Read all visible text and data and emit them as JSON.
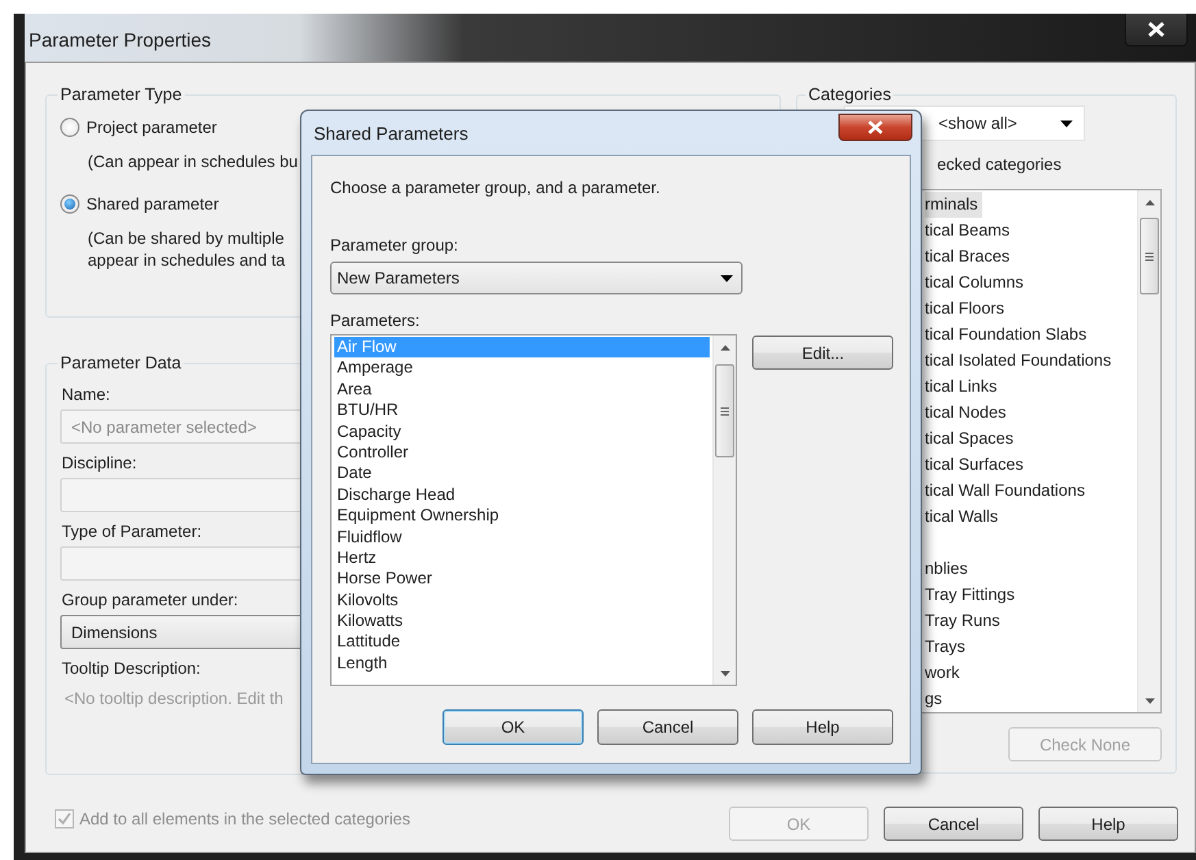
{
  "window": {
    "title": "Parameter Properties"
  },
  "parameter_type": {
    "title": "Parameter Type",
    "options": [
      {
        "label": "Project parameter",
        "note": [
          "(Can appear in schedules bu"
        ],
        "selected": false
      },
      {
        "label": "Shared parameter",
        "note": [
          "(Can be shared by multiple",
          "appear in schedules and ta"
        ],
        "selected": true
      }
    ]
  },
  "parameter_data": {
    "title": "Parameter Data",
    "fields": [
      {
        "kind": "text",
        "label": "Name:",
        "placeholder": "<No parameter selected>",
        "disabled": true
      },
      {
        "kind": "select",
        "label": "Discipline:",
        "disabled": true
      },
      {
        "kind": "select",
        "label": "Type of Parameter:",
        "disabled": true
      },
      {
        "kind": "select",
        "label": "Group parameter under:",
        "value": "Dimensions",
        "disabled": false
      },
      {
        "kind": "note",
        "label": "Tooltip Description:",
        "value": "<No tooltip description. Edit th"
      }
    ]
  },
  "categories": {
    "title": "Categories",
    "filter": "<show all>",
    "hide_unchecked_label": "ecked categories",
    "items": [
      {
        "label": "rminals",
        "selected": true
      },
      {
        "label": "tical Beams",
        "selected": false
      },
      {
        "label": "tical Braces",
        "selected": false
      },
      {
        "label": "tical Columns",
        "selected": false
      },
      {
        "label": "tical Floors",
        "selected": false
      },
      {
        "label": "tical Foundation Slabs",
        "selected": false
      },
      {
        "label": "tical Isolated Foundations",
        "selected": false
      },
      {
        "label": "tical Links",
        "selected": false
      },
      {
        "label": "tical Nodes",
        "selected": false
      },
      {
        "label": "tical Spaces",
        "selected": false
      },
      {
        "label": "tical Surfaces",
        "selected": false
      },
      {
        "label": "tical Wall Foundations",
        "selected": false
      },
      {
        "label": "tical Walls",
        "selected": false
      },
      {
        "label": "nblies",
        "selected": false
      },
      {
        "label": "Tray Fittings",
        "selected": false
      },
      {
        "label": "Tray Runs",
        "selected": false
      },
      {
        "label": "Trays",
        "selected": false
      },
      {
        "label": "work",
        "selected": false
      },
      {
        "label": "gs",
        "selected": false
      }
    ],
    "buttons": [
      {
        "label": "Check None",
        "disabled": true
      }
    ]
  },
  "add_to_all": {
    "label": "Add to all elements in the selected categories",
    "checked": true,
    "disabled": true
  },
  "buttons": [
    {
      "label": "OK",
      "disabled": true
    },
    {
      "label": "Cancel",
      "disabled": false
    },
    {
      "label": "Help",
      "disabled": false
    }
  ],
  "shared_dialog": {
    "title": "Shared Parameters",
    "instruction": "Choose a parameter group, and a parameter.",
    "group_label": "Parameter group:",
    "group_value": "New Parameters",
    "parameters_label": "Parameters:",
    "parameters": [
      {
        "label": "Air Flow",
        "selected": true
      },
      {
        "label": "Amperage",
        "selected": false
      },
      {
        "label": "Area",
        "selected": false
      },
      {
        "label": "BTU/HR",
        "selected": false
      },
      {
        "label": "Capacity",
        "selected": false
      },
      {
        "label": "Controller",
        "selected": false
      },
      {
        "label": "Date",
        "selected": false
      },
      {
        "label": "Discharge Head",
        "selected": false
      },
      {
        "label": "Equipment Ownership",
        "selected": false
      },
      {
        "label": "Fluidflow",
        "selected": false
      },
      {
        "label": "Hertz",
        "selected": false
      },
      {
        "label": "Horse Power",
        "selected": false
      },
      {
        "label": "Kilovolts",
        "selected": false
      },
      {
        "label": "Kilowatts",
        "selected": false
      },
      {
        "label": "Lattitude",
        "selected": false
      },
      {
        "label": "Length",
        "selected": false
      }
    ],
    "edit_button": "Edit...",
    "buttons": [
      {
        "label": "OK",
        "default": true
      },
      {
        "label": "Cancel",
        "default": false
      },
      {
        "label": "Help",
        "default": false
      }
    ]
  }
}
